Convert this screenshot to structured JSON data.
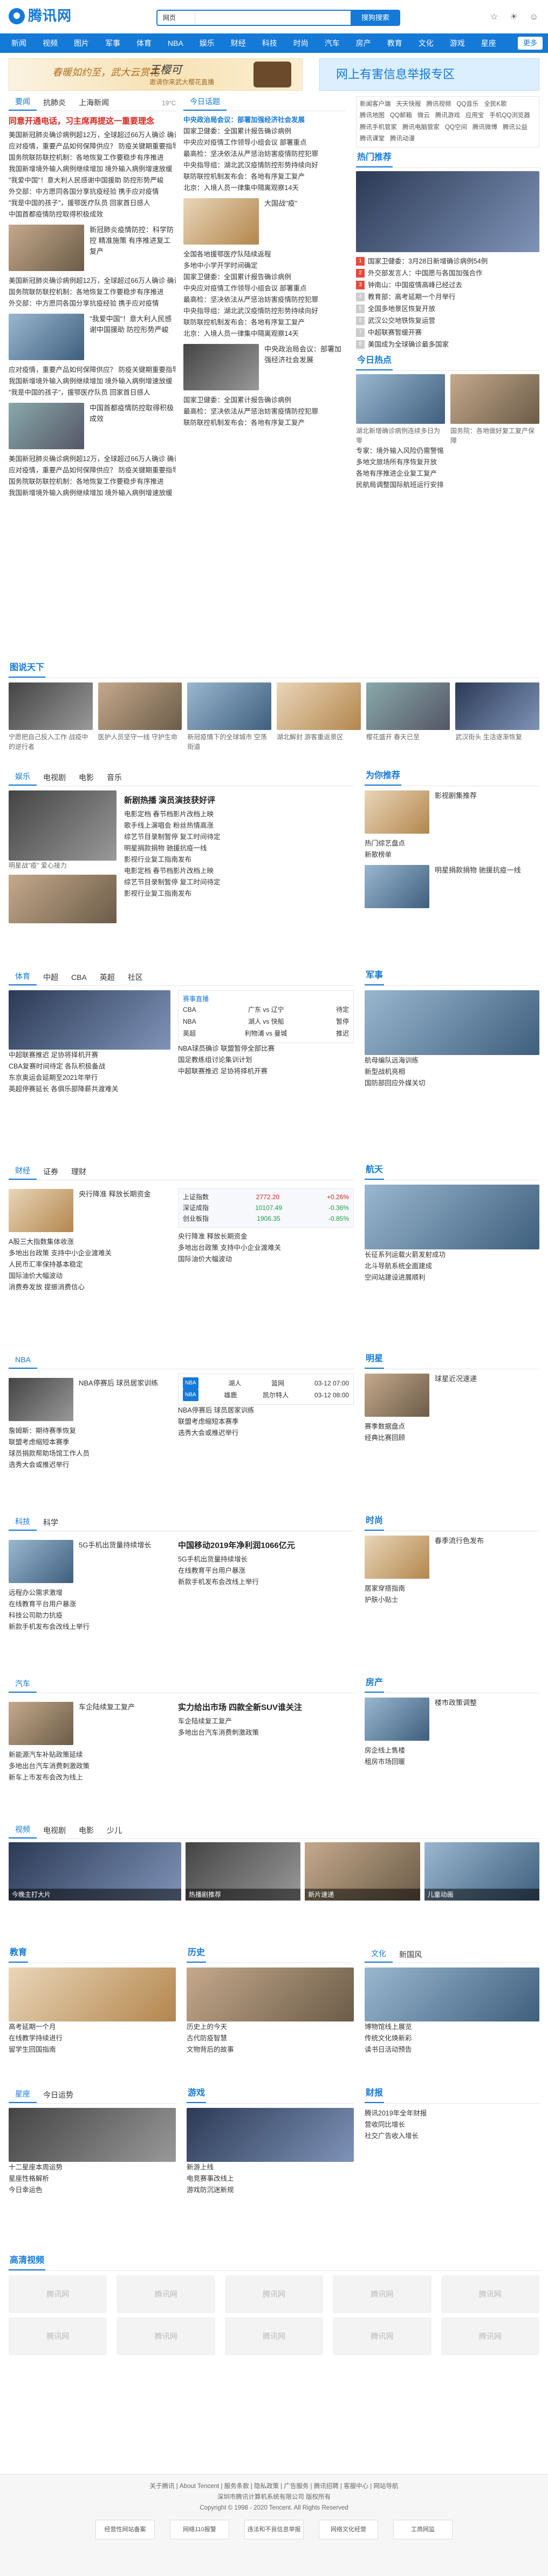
{
  "header": {
    "logo_text": "腾讯网",
    "search_select": "网页",
    "search_placeholder": "",
    "search_button": "搜狗搜索",
    "icons": [
      "star-icon",
      "weather-icon",
      "user-icon"
    ]
  },
  "nav": {
    "items": [
      "新闻",
      "视频",
      "图片",
      "军事",
      "体育",
      "NBA",
      "娱乐",
      "财经",
      "科技",
      "时尚",
      "汽车",
      "房产",
      "教育",
      "文化",
      "游戏",
      "星座",
      "视频"
    ],
    "more": "更多"
  },
  "banners": {
    "left_t1": "春暖如约至，武大云赏花",
    "left_t2": "王樱可",
    "left_t3": "邀请你来武大樱花直播",
    "right": "网上有害信息举报专区"
  },
  "main_tabs": [
    "要闻",
    "抗肺炎",
    "上海新闻"
  ],
  "weather": "19°C",
  "news_top": {
    "headline": "同意开通电话，习主席再提这一重要理念",
    "items": [
      "美国新冠肺炎确诊病例超12万，全球超过66万人确诊 确诊病例仍在快速上升",
      "应对疫情，重要产品如何保障供应？ 防疫关键期重要指导",
      "国务院联防联控机制：各地恢复工作要稳步有序推进",
      "我国新增境外输入病例继续增加 境外输入病例增速放缓",
      "\"我爱中国\"！意大利人民感谢中国援助 防控形势严峻",
      "外交部：中方愿同各国分享抗疫经验 携手应对疫情",
      "\"我是中国的孩子\"，援鄂医疗队员 回家首日感人",
      "中国首都疫情防控取得积极成效"
    ],
    "feature_text": "新冠肺炎疫情防控：科学防控 精准施策 有序推进复工复产"
  },
  "today": {
    "label": "今日话题",
    "items": [
      "中央政治局会议：部署加强经济社会发展",
      "国家卫健委：全国累计报告确诊病例",
      "中央应对疫情工作领导小组会议 部署重点",
      "最高检：坚决依法从严惩治妨害疫情防控犯罪",
      "中央指导组：湖北武汉疫情防控形势持续向好",
      "联防联控机制发布会：各地有序复工复产",
      "北京：入境人员一律集中隔离观察14天"
    ],
    "feature_caption": "大国战\"疫\"",
    "feature_items": [
      "全国各地援鄂医疗队陆续返程",
      "多地中小学开学时间确定"
    ]
  },
  "side": {
    "apps": [
      "新闻客户端",
      "天天快报",
      "腾讯视频",
      "QQ音乐",
      "全民K歌",
      "腾讯地图",
      "QQ邮箱",
      "微云",
      "腾讯游戏",
      "应用宝",
      "手机QQ浏览器",
      "腾讯手机管家",
      "腾讯电脑管家",
      "QQ空间",
      "腾讯微博",
      "腾讯公益",
      "腾讯课堂",
      "腾讯动漫"
    ],
    "hot_title": "热门推荐",
    "hot_items": [
      "国家卫健委：3月28日新增确诊病例54例",
      "外交部发言人：中国愿与各国加强合作",
      "钟南山：中国疫情高峰已经过去",
      "教育部：高考延期一个月举行",
      "全国多地景区恢复开放",
      "武汉公交地铁恢复运营",
      "中超联赛暂缓开赛",
      "美国成为全球确诊最多国家"
    ],
    "today_hot": "今日热点",
    "side_news": [
      "湖北新增确诊病例连续多日为零",
      "国务院：各地做好复工复产保障",
      "专家：境外输入风险仍需警惕",
      "多地文旅场所有序恢复开放",
      "各地有序推进企业复工复产",
      "民航局调整国际航班运行安排"
    ]
  },
  "photos": {
    "label": "图说天下",
    "caps": [
      "宁愿把自己投入工作 战疫中的逆行者",
      "医护人员坚守一线 守护生命",
      "新冠疫情下的全球城市 空荡街道",
      "湖北解封 游客重返景区",
      "樱花盛开 春天已至",
      "武汉街头 生活逐渐恢复"
    ]
  },
  "ent": {
    "tabs": [
      "娱乐",
      "电视剧",
      "电影",
      "音乐"
    ],
    "items": [
      "新剧热播 演员演技获好评",
      "电影定档 春节档影片改档上映",
      "歌手线上演唱会 粉丝热情高涨",
      "综艺节目录制暂停 复工时间待定",
      "明星捐款捐物 驰援抗疫一线",
      "影视行业复工指南发布"
    ],
    "feature_caption": "明星战\"疫\" 爱心接力",
    "side_title": "为你推荐",
    "side_items": [
      "影视剧集推荐",
      "热门综艺盘点",
      "新歌榜单"
    ]
  },
  "sports": {
    "tabs": [
      "体育",
      "中超",
      "CBA",
      "英超",
      "社区"
    ],
    "items": [
      "中超联赛推迟 足协将择机开赛",
      "CBA复赛时间待定 各队积极备战",
      "东京奥运会延期至2021年举行",
      "英超停赛延长 各俱乐部降薪共渡难关",
      "NBA球员确诊 联盟暂停全部比赛",
      "国足教练组讨论集训计划"
    ],
    "score_title": "赛事直播",
    "scores": [
      {
        "league": "CBA",
        "teams": "广东 vs 辽宁",
        "time": "待定"
      },
      {
        "league": "NBA",
        "teams": "湖人 vs 快船",
        "time": "暂停"
      },
      {
        "league": "英超",
        "teams": "利物浦 vs 曼城",
        "time": "推迟"
      }
    ],
    "mil_title": "军事",
    "mil_items": [
      "航母编队远海训练",
      "新型战机亮相",
      "国防部回应外媒关切"
    ]
  },
  "finance": {
    "tabs": [
      "财经",
      "证券",
      "理财"
    ],
    "items": [
      "央行降准 释放长期资金",
      "A股三大指数集体收涨",
      "多地出台政策 支持中小企业渡难关",
      "人民币汇率保持基本稳定",
      "国际油价大幅波动",
      "消费券发放 提振消费信心"
    ],
    "quotes": [
      {
        "name": "上证指数",
        "value": "2772.20",
        "chg": "+0.26%"
      },
      {
        "name": "深证成指",
        "value": "10107.49",
        "chg": "-0.36%"
      },
      {
        "name": "创业板指",
        "value": "1906.35",
        "chg": "-0.85%"
      }
    ],
    "mil_title": "航天",
    "mil_items": [
      "长征系列运载火箭发射成功",
      "北斗导航系统全面建成",
      "空间站建设进展顺利"
    ]
  },
  "nba": {
    "tabs": [
      "NBA"
    ],
    "items": [
      "NBA停赛后 球员居家训练",
      "詹姆斯：期待赛季恢复",
      "联盟考虑缩短本赛季",
      "球员捐款帮助场馆工作人员",
      "选秀大会或推迟举行"
    ],
    "scores": [
      {
        "t1": "湖人",
        "t2": "篮网",
        "time": "03-12 07:00"
      },
      {
        "t1": "雄鹿",
        "t2": "凯尔特人",
        "time": "03-12 08:00"
      }
    ],
    "side_title": "明星",
    "side_items": [
      "球星近况速递",
      "赛季数据盘点",
      "经典比赛回顾"
    ]
  },
  "tech": {
    "tabs": [
      "科技",
      "科学"
    ],
    "items": [
      "5G手机出货量持续增长",
      "远程办公需求激增",
      "在线教育平台用户暴涨",
      "科技公司助力抗疫",
      "新款手机发布会改线上举行"
    ],
    "headline": "中国移动2019年净利润1066亿元",
    "side_title": "时尚",
    "side_items": [
      "春季流行色发布",
      "居家穿搭指南",
      "护肤小贴士"
    ]
  },
  "auto": {
    "tabs": [
      "汽车"
    ],
    "items": [
      "车企陆续复工复产",
      "新能源汽车补贴政策延续",
      "多地出台汽车消费刺激政策",
      "新车上市发布会改为线上"
    ],
    "headline": "实力给出市场 四款全新SUV谁关注",
    "side_title": "房产",
    "side_items": [
      "楼市政策调整",
      "房企线上售楼",
      "租房市场回暖"
    ]
  },
  "videos": {
    "tabs": [
      "视频",
      "电视剧",
      "电影",
      "少儿"
    ],
    "items": [
      "今晚主打大片",
      "热播剧推荐",
      "新片速递",
      "儿童动画"
    ]
  },
  "edu": {
    "title": "教育",
    "items": [
      "高考延期一个月",
      "在线教学持续进行",
      "留学生回国指南"
    ]
  },
  "history": {
    "title": "历史",
    "items": [
      "历史上的今天",
      "古代防疫智慧",
      "文物背后的故事"
    ]
  },
  "culture": {
    "tabs": [
      "文化",
      "新国风"
    ],
    "items": [
      "博物馆线上展览",
      "传统文化焕新彩",
      "读书日活动预告"
    ]
  },
  "astro": {
    "tabs": [
      "星座",
      "今日运势"
    ],
    "items": [
      "十二星座本周运势",
      "星座性格解析",
      "今日幸运色"
    ]
  },
  "game": {
    "title": "游戏",
    "items": [
      "新游上线",
      "电竞赛事改线上",
      "游戏防沉迷新规"
    ]
  },
  "caifu": {
    "title": "财报",
    "items": [
      "腾讯2019年全年财报",
      "营收同比增长",
      "社交广告收入增长"
    ]
  },
  "blank": {
    "title": "高清视频",
    "logos": [
      "腾讯网",
      "腾讯网",
      "腾讯网",
      "腾讯网",
      "腾讯网"
    ]
  },
  "footer": {
    "links": "关于腾讯 | About Tencent | 服务条款 | 隐私政策 | 广告服务 | 腾讯招聘 | 客服中心 | 网站导航",
    "copy": "Copyright © 1998 - 2020 Tencent. All Rights Reserved",
    "company": "深圳市腾讯计算机系统有限公司 版权所有",
    "badges": [
      "经营性网站备案",
      "网络110报警",
      "违法和不良信息举报",
      "网络文化经营",
      "工商网监"
    ]
  }
}
